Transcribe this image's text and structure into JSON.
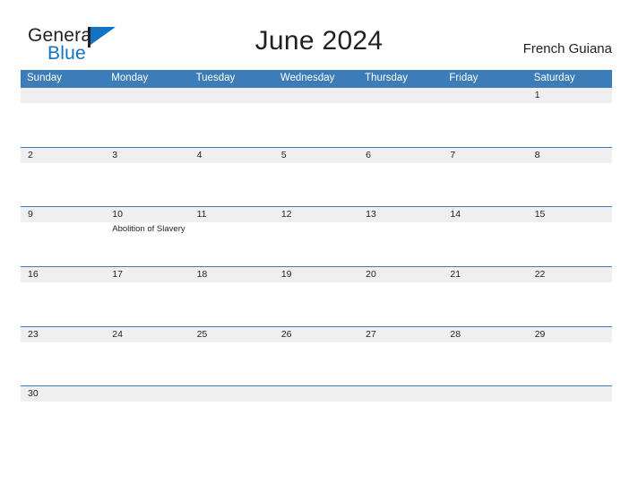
{
  "brand": {
    "name_part1": "General",
    "name_part2": "Blue",
    "logo_icon": "flag-triangle-icon",
    "accent_color": "#1273c4",
    "dark_color": "#231f20"
  },
  "header": {
    "title": "June 2024",
    "region": "French Guiana"
  },
  "theme": {
    "header_blue": "#3c7cb8",
    "row_band_gray": "#efefef",
    "page_background": "#ffffff",
    "text_color": "#231f20"
  },
  "calendar": {
    "weekday_headers": [
      "Sunday",
      "Monday",
      "Tuesday",
      "Wednesday",
      "Thursday",
      "Friday",
      "Saturday"
    ],
    "weeks": [
      [
        {
          "date": ""
        },
        {
          "date": ""
        },
        {
          "date": ""
        },
        {
          "date": ""
        },
        {
          "date": ""
        },
        {
          "date": ""
        },
        {
          "date": "1",
          "events": []
        }
      ],
      [
        {
          "date": "2",
          "events": []
        },
        {
          "date": "3",
          "events": []
        },
        {
          "date": "4",
          "events": []
        },
        {
          "date": "5",
          "events": []
        },
        {
          "date": "6",
          "events": []
        },
        {
          "date": "7",
          "events": []
        },
        {
          "date": "8",
          "events": []
        }
      ],
      [
        {
          "date": "9",
          "events": []
        },
        {
          "date": "10",
          "events": [
            "Abolition of Slavery"
          ]
        },
        {
          "date": "11",
          "events": []
        },
        {
          "date": "12",
          "events": []
        },
        {
          "date": "13",
          "events": []
        },
        {
          "date": "14",
          "events": []
        },
        {
          "date": "15",
          "events": []
        }
      ],
      [
        {
          "date": "16",
          "events": []
        },
        {
          "date": "17",
          "events": []
        },
        {
          "date": "18",
          "events": []
        },
        {
          "date": "19",
          "events": []
        },
        {
          "date": "20",
          "events": []
        },
        {
          "date": "21",
          "events": []
        },
        {
          "date": "22",
          "events": []
        }
      ],
      [
        {
          "date": "23",
          "events": []
        },
        {
          "date": "24",
          "events": []
        },
        {
          "date": "25",
          "events": []
        },
        {
          "date": "26",
          "events": []
        },
        {
          "date": "27",
          "events": []
        },
        {
          "date": "28",
          "events": []
        },
        {
          "date": "29",
          "events": []
        }
      ],
      [
        {
          "date": "30",
          "events": []
        },
        {
          "date": ""
        },
        {
          "date": ""
        },
        {
          "date": ""
        },
        {
          "date": ""
        },
        {
          "date": ""
        },
        {
          "date": ""
        }
      ]
    ]
  }
}
